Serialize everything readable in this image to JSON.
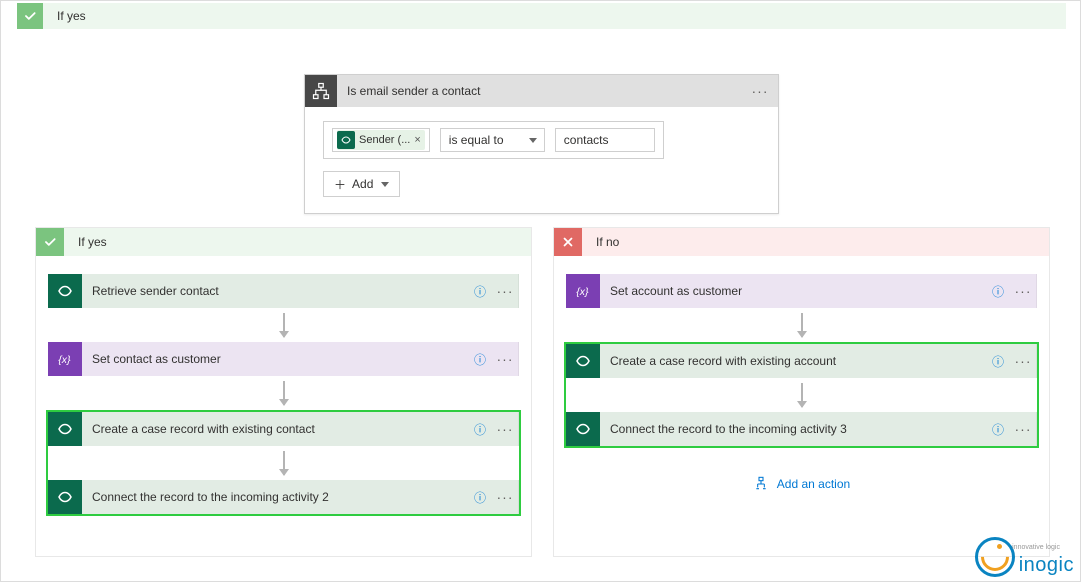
{
  "top_branch": {
    "label": "If yes"
  },
  "condition": {
    "title": "Is email sender a contact",
    "token_label": "Sender (...",
    "operator": "is equal to",
    "value": "contacts",
    "add_label": "Add"
  },
  "yes_branch": {
    "label": "If yes",
    "steps": [
      {
        "type": "dataverse",
        "label": "Retrieve sender contact"
      },
      {
        "type": "variable",
        "label": "Set contact as customer"
      },
      {
        "type": "dataverse",
        "label": "Create a case record with existing contact"
      },
      {
        "type": "dataverse",
        "label": "Connect the record to the incoming activity 2"
      }
    ]
  },
  "no_branch": {
    "label": "If no",
    "steps": [
      {
        "type": "variable",
        "label": "Set account as customer"
      },
      {
        "type": "dataverse",
        "label": "Create a case record with existing account"
      },
      {
        "type": "dataverse",
        "label": "Connect the record to the incoming activity 3"
      }
    ],
    "add_action_label": "Add an action"
  },
  "logo": {
    "text": "inogic",
    "sub": "innovative logic"
  }
}
